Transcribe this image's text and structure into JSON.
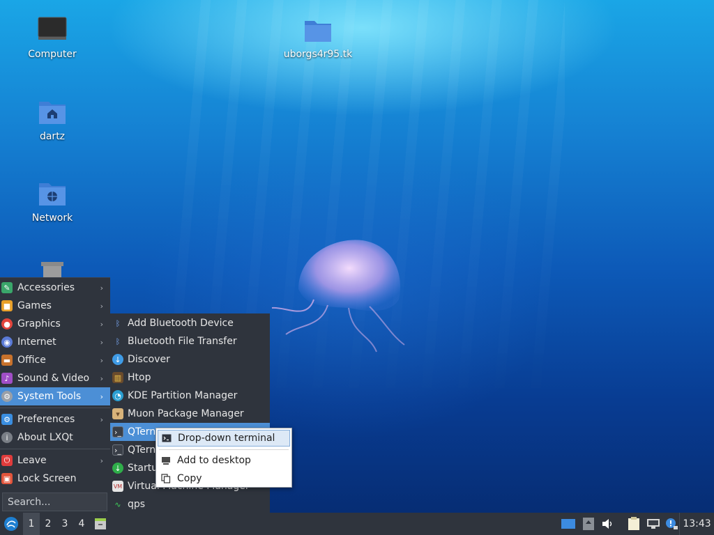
{
  "desktop": {
    "icons": [
      {
        "label": "Computer",
        "icon": "monitor-icon"
      },
      {
        "label": "uborgs4r95.tk",
        "icon": "folder-icon"
      },
      {
        "label": "dartz",
        "icon": "home-folder-icon"
      },
      {
        "label": "Network",
        "icon": "network-folder-icon"
      },
      {
        "label": "",
        "icon": "trash-icon"
      }
    ]
  },
  "main_menu": {
    "items": [
      {
        "label": "Accessories",
        "icon": "accessories-icon",
        "color": "#3aa66a",
        "has_sub": true
      },
      {
        "label": "Games",
        "icon": "games-icon",
        "color": "#e8a02a",
        "has_sub": true
      },
      {
        "label": "Graphics",
        "icon": "graphics-icon",
        "color": "#e2453c",
        "has_sub": true
      },
      {
        "label": "Internet",
        "icon": "internet-icon",
        "color": "#5a7ad6",
        "has_sub": true
      },
      {
        "label": "Office",
        "icon": "office-icon",
        "color": "#c8722c",
        "has_sub": true
      },
      {
        "label": "Sound & Video",
        "icon": "sound-video-icon",
        "color": "#a04ec6",
        "has_sub": true
      },
      {
        "label": "System Tools",
        "icon": "system-tools-icon",
        "color": "#9aa0a8",
        "has_sub": true,
        "active": true
      },
      {
        "label": "Preferences",
        "icon": "preferences-icon",
        "color": "#3a8ee0",
        "has_sub": true
      },
      {
        "label": "About LXQt",
        "icon": "info-icon",
        "color": "#7a7f86",
        "has_sub": false
      },
      {
        "label": "Leave",
        "icon": "power-icon",
        "color": "#e03c3c",
        "has_sub": true
      },
      {
        "label": "Lock Screen",
        "icon": "lock-icon",
        "color": "#e2553c",
        "has_sub": false
      }
    ],
    "search_placeholder": "Search..."
  },
  "system_tools_menu": {
    "items": [
      {
        "label": "Add Bluetooth Device",
        "icon": "bluetooth-icon"
      },
      {
        "label": "Bluetooth File Transfer",
        "icon": "bluetooth-icon"
      },
      {
        "label": "Discover",
        "icon": "discover-icon"
      },
      {
        "label": "Htop",
        "icon": "htop-icon"
      },
      {
        "label": "KDE Partition Manager",
        "icon": "partition-manager-icon"
      },
      {
        "label": "Muon Package Manager",
        "icon": "package-manager-icon"
      },
      {
        "label": "QTerminal",
        "display": "QTern",
        "icon": "terminal-icon",
        "active": true
      },
      {
        "label": "QTerminal",
        "display": "QTern",
        "icon": "terminal-icon"
      },
      {
        "label": "Startup",
        "display": "Startu",
        "icon": "startup-icon"
      },
      {
        "label": "Virtual Machine Manager",
        "icon": "virt-manager-icon"
      },
      {
        "label": "qps",
        "icon": "qps-icon"
      }
    ]
  },
  "context_menu": {
    "items": [
      {
        "label": "Drop-down terminal",
        "icon": "terminal-icon",
        "highlighted": true
      },
      {
        "label": "Add to desktop",
        "icon": "add-desktop-icon"
      },
      {
        "label": "Copy",
        "icon": "copy-icon"
      }
    ]
  },
  "taskbar": {
    "workspaces": [
      "1",
      "2",
      "3",
      "4"
    ],
    "active_workspace": "1",
    "clock": "13:43",
    "tray_icons": [
      "show-desktop-icon",
      "update-notifier-icon",
      "volume-icon",
      "clipboard-icon",
      "network-icon",
      "notification-icon"
    ]
  }
}
